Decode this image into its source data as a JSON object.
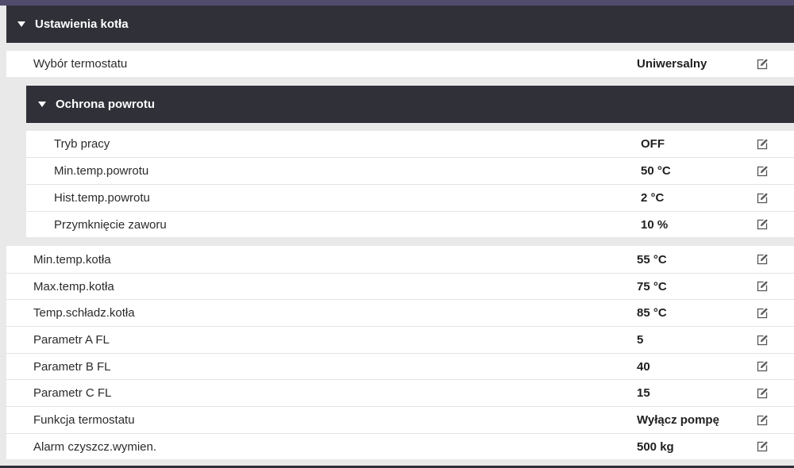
{
  "colors": {
    "header_bg": "#2f3038",
    "top_strip": "#514c6c",
    "page_bg": "#e9e9e9",
    "row_bg": "#ffffff"
  },
  "section": {
    "title": "Ustawienia kotła",
    "icon": "triangle-down-icon"
  },
  "thermostat_row": {
    "label": "Wybór termostatu",
    "value": "Uniwersalny",
    "edit_icon": "edit-icon"
  },
  "subsection": {
    "title": "Ochrona powrotu",
    "icon": "triangle-down-icon",
    "rows": [
      {
        "label": "Tryb pracy",
        "value": "OFF"
      },
      {
        "label": "Min.temp.powrotu",
        "value": "50 °C"
      },
      {
        "label": "Hist.temp.powrotu",
        "value": "2 °C"
      },
      {
        "label": "Przymknięcie zaworu",
        "value": "10 %"
      }
    ]
  },
  "rows": [
    {
      "label": "Min.temp.kotła",
      "value": "55 °C"
    },
    {
      "label": "Max.temp.kotła",
      "value": "75 °C"
    },
    {
      "label": "Temp.schładz.kotła",
      "value": "85 °C"
    },
    {
      "label": "Parametr A FL",
      "value": "5"
    },
    {
      "label": "Parametr B FL",
      "value": "40"
    },
    {
      "label": "Parametr C FL",
      "value": "15"
    },
    {
      "label": "Funkcja termostatu",
      "value": "Wyłącz pompę"
    },
    {
      "label": "Alarm czyszcz.wymien.",
      "value": "500 kg"
    }
  ]
}
